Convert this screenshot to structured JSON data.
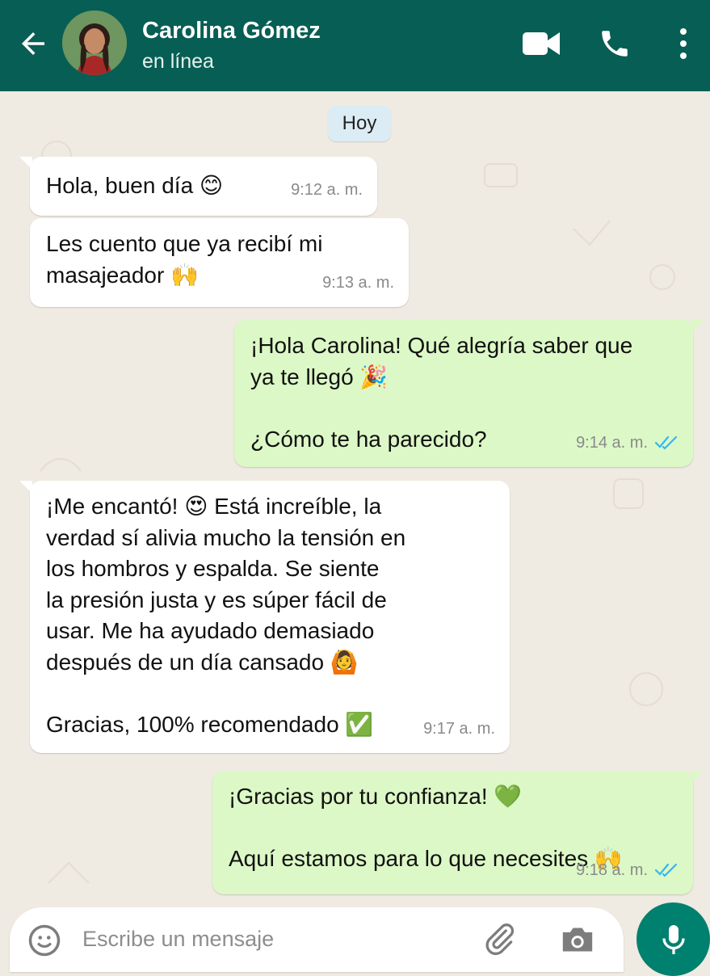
{
  "header": {
    "contact_name": "Carolina Gómez",
    "status": "en línea",
    "icons": [
      "back-arrow-icon",
      "video-call-icon",
      "phone-icon",
      "more-vert-icon"
    ],
    "color": "#075e54"
  },
  "chat": {
    "date_label": "Hoy",
    "messages": [
      {
        "direction": "in",
        "text": "Hola, buen día 😊",
        "time": "9:12 a. m."
      },
      {
        "direction": "in",
        "text": "Les cuento que ya recibí mi\nmasajeador 🙌",
        "time": "9:13 a. m."
      },
      {
        "direction": "out",
        "text": "¡Hola Carolina! Qué alegría saber que\nya te llegó 🎉\n\n¿Cómo te ha parecido?",
        "time": "9:14 a. m.",
        "read": true
      },
      {
        "direction": "in",
        "text": "¡Me encantó! 😍 Está increíble, la\nverdad sí alivia mucho la tensión en\nlos hombros y espalda. Se siente\nla presión justa y es súper fácil de\nusar. Me ha ayudado demasiado\ndespués de un día cansado 🙆\n\nGracias, 100% recomendado ✅",
        "time": "9:17 a. m."
      },
      {
        "direction": "out",
        "text": "¡Gracias por tu confianza! 💚\n\nAquí estamos para lo que necesites 🙌",
        "time": "9:18 a. m.",
        "read": true
      }
    ]
  },
  "composer": {
    "placeholder": "Escribe un mensaje",
    "icons": [
      "emoji-icon",
      "attach-icon",
      "camera-icon",
      "mic-icon"
    ]
  },
  "colors": {
    "incoming_bubble": "#ffffff",
    "outgoing_bubble": "#dcf8c6",
    "chat_background": "#efeae2",
    "read_check": "#34b7f1",
    "mic_button": "#00806e"
  }
}
